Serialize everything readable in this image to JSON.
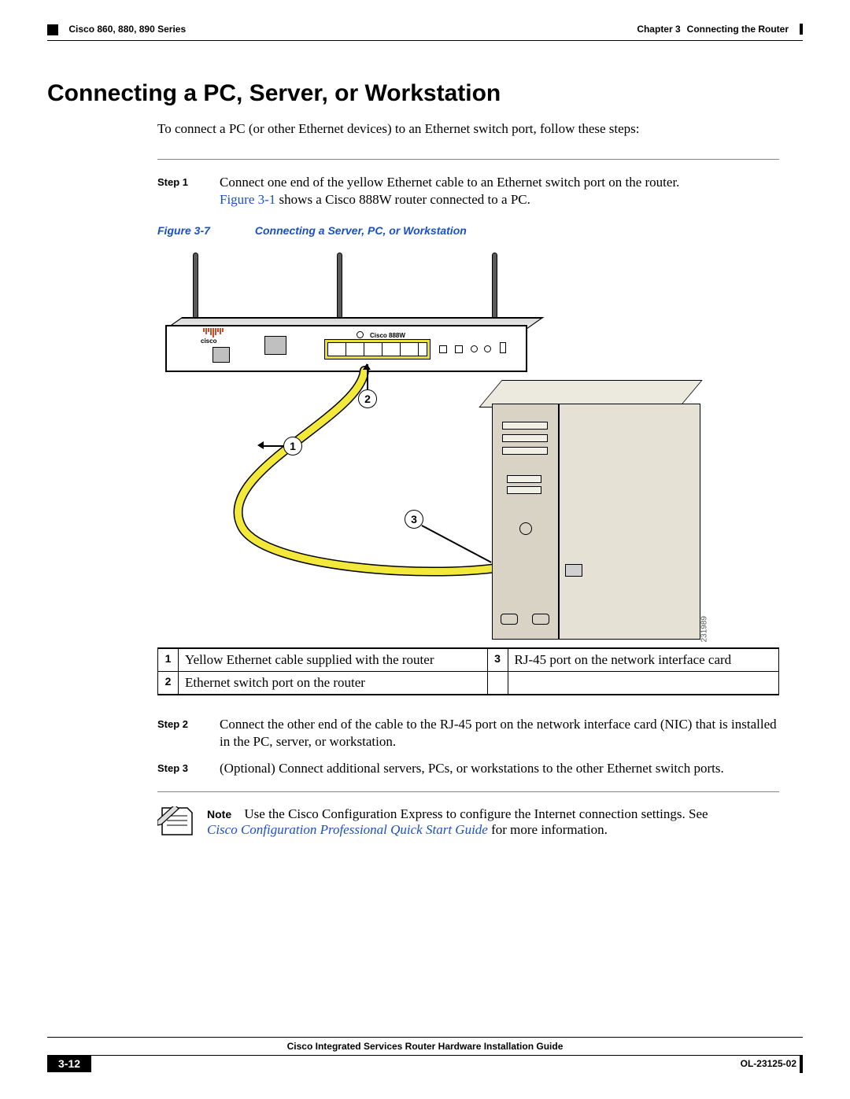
{
  "header": {
    "series": "Cisco 860, 880, 890 Series",
    "chapter": "Chapter 3",
    "chapter_title": "Connecting the Router"
  },
  "section_title": "Connecting a PC, Server, or Workstation",
  "intro": "To connect a PC (or other Ethernet devices) to an Ethernet switch port, follow these steps:",
  "steps": [
    {
      "label": "Step 1",
      "text": "Connect one end of the yellow Ethernet cable to an Ethernet switch port on the router.",
      "xref": "Figure 3-1",
      "xref_tail": " shows a Cisco 888W router connected to a PC."
    },
    {
      "label": "Step 2",
      "text": "Connect the other end of the cable to the RJ-45 port on the network interface card (NIC) that is installed in the PC, server, or workstation."
    },
    {
      "label": "Step 3",
      "text": "(Optional) Connect additional servers, PCs, or workstations to the other Ethernet switch ports."
    }
  ],
  "figure": {
    "number": "Figure 3-7",
    "caption": "Connecting a Server, PC, or Workstation",
    "router_model": "Cisco 888W",
    "cisco_label": "cisco",
    "art_number": "231989",
    "callouts": {
      "c1": "1",
      "c2": "2",
      "c3": "3"
    }
  },
  "legend": {
    "r1n": "1",
    "r1t": "Yellow Ethernet cable supplied with the router",
    "r2n": "3",
    "r2t": "RJ-45 port on the network interface card",
    "r3n": "2",
    "r3t": "Ethernet switch port on the router"
  },
  "note": {
    "label": "Note",
    "text_lead": "Use the Cisco Configuration Express to configure the Internet connection settings. See ",
    "link": "Cisco Configuration Professional Quick Start Guide",
    "text_tail": " for more information."
  },
  "footer": {
    "guide_title": "Cisco Integrated Services Router Hardware Installation Guide",
    "page_number": "3-12",
    "doc_id": "OL-23125-02"
  }
}
